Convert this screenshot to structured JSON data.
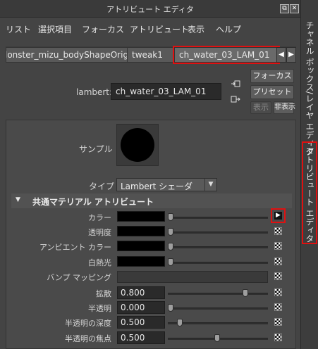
{
  "window": {
    "title": "アトリビュート エディタ",
    "buttons": [
      "⧉",
      "✕"
    ]
  },
  "menu": [
    "リスト",
    "選択項目",
    "フォーカス",
    "アトリビュート",
    "表示",
    "ヘルプ"
  ],
  "tabs": [
    {
      "label": "lonster_mizu_bodyShapeOrig",
      "active": false
    },
    {
      "label": "tweak1",
      "active": false
    },
    {
      "label": "ch_water_03_LAM_01",
      "active": true
    }
  ],
  "header": {
    "node_type_label": "lambert:",
    "node_name": "ch_water_03_LAM_01",
    "focus_button": "フォーカス",
    "preset_button": "プリセット",
    "show_button": "表示",
    "hide_button": "非表示"
  },
  "swatch": {
    "label": "サンプル"
  },
  "type_row": {
    "label": "タイプ",
    "value": "Lambert シェーダ"
  },
  "section": {
    "title": "共通マテリアル アトリビュート"
  },
  "attributes": [
    {
      "label": "カラー",
      "kind": "color",
      "color": "#000000",
      "slider": 0.0
    },
    {
      "label": "透明度",
      "kind": "color",
      "color": "#000000",
      "slider": 0.0
    },
    {
      "label": "アンビエント カラー",
      "kind": "color",
      "color": "#000000",
      "slider": 0.0
    },
    {
      "label": "白熱光",
      "kind": "color",
      "color": "#000000",
      "slider": 0.0
    },
    {
      "label": "バンプ マッピング",
      "kind": "map"
    },
    {
      "label": "拡散",
      "kind": "number",
      "value": "0.800",
      "slider": 0.8
    },
    {
      "label": "半透明",
      "kind": "number",
      "value": "0.000",
      "slider": 0.0
    },
    {
      "label": "半透明の深度",
      "kind": "number",
      "value": "0.500",
      "slider": 0.1
    },
    {
      "label": "半透明の焦点",
      "kind": "number",
      "value": "0.500",
      "slider": 0.5
    }
  ],
  "side_tabs": [
    "チャネル ボックス/レイヤ エディタ",
    "アトリビュート エディタ"
  ],
  "colors": {
    "highlight": "#e01010"
  }
}
